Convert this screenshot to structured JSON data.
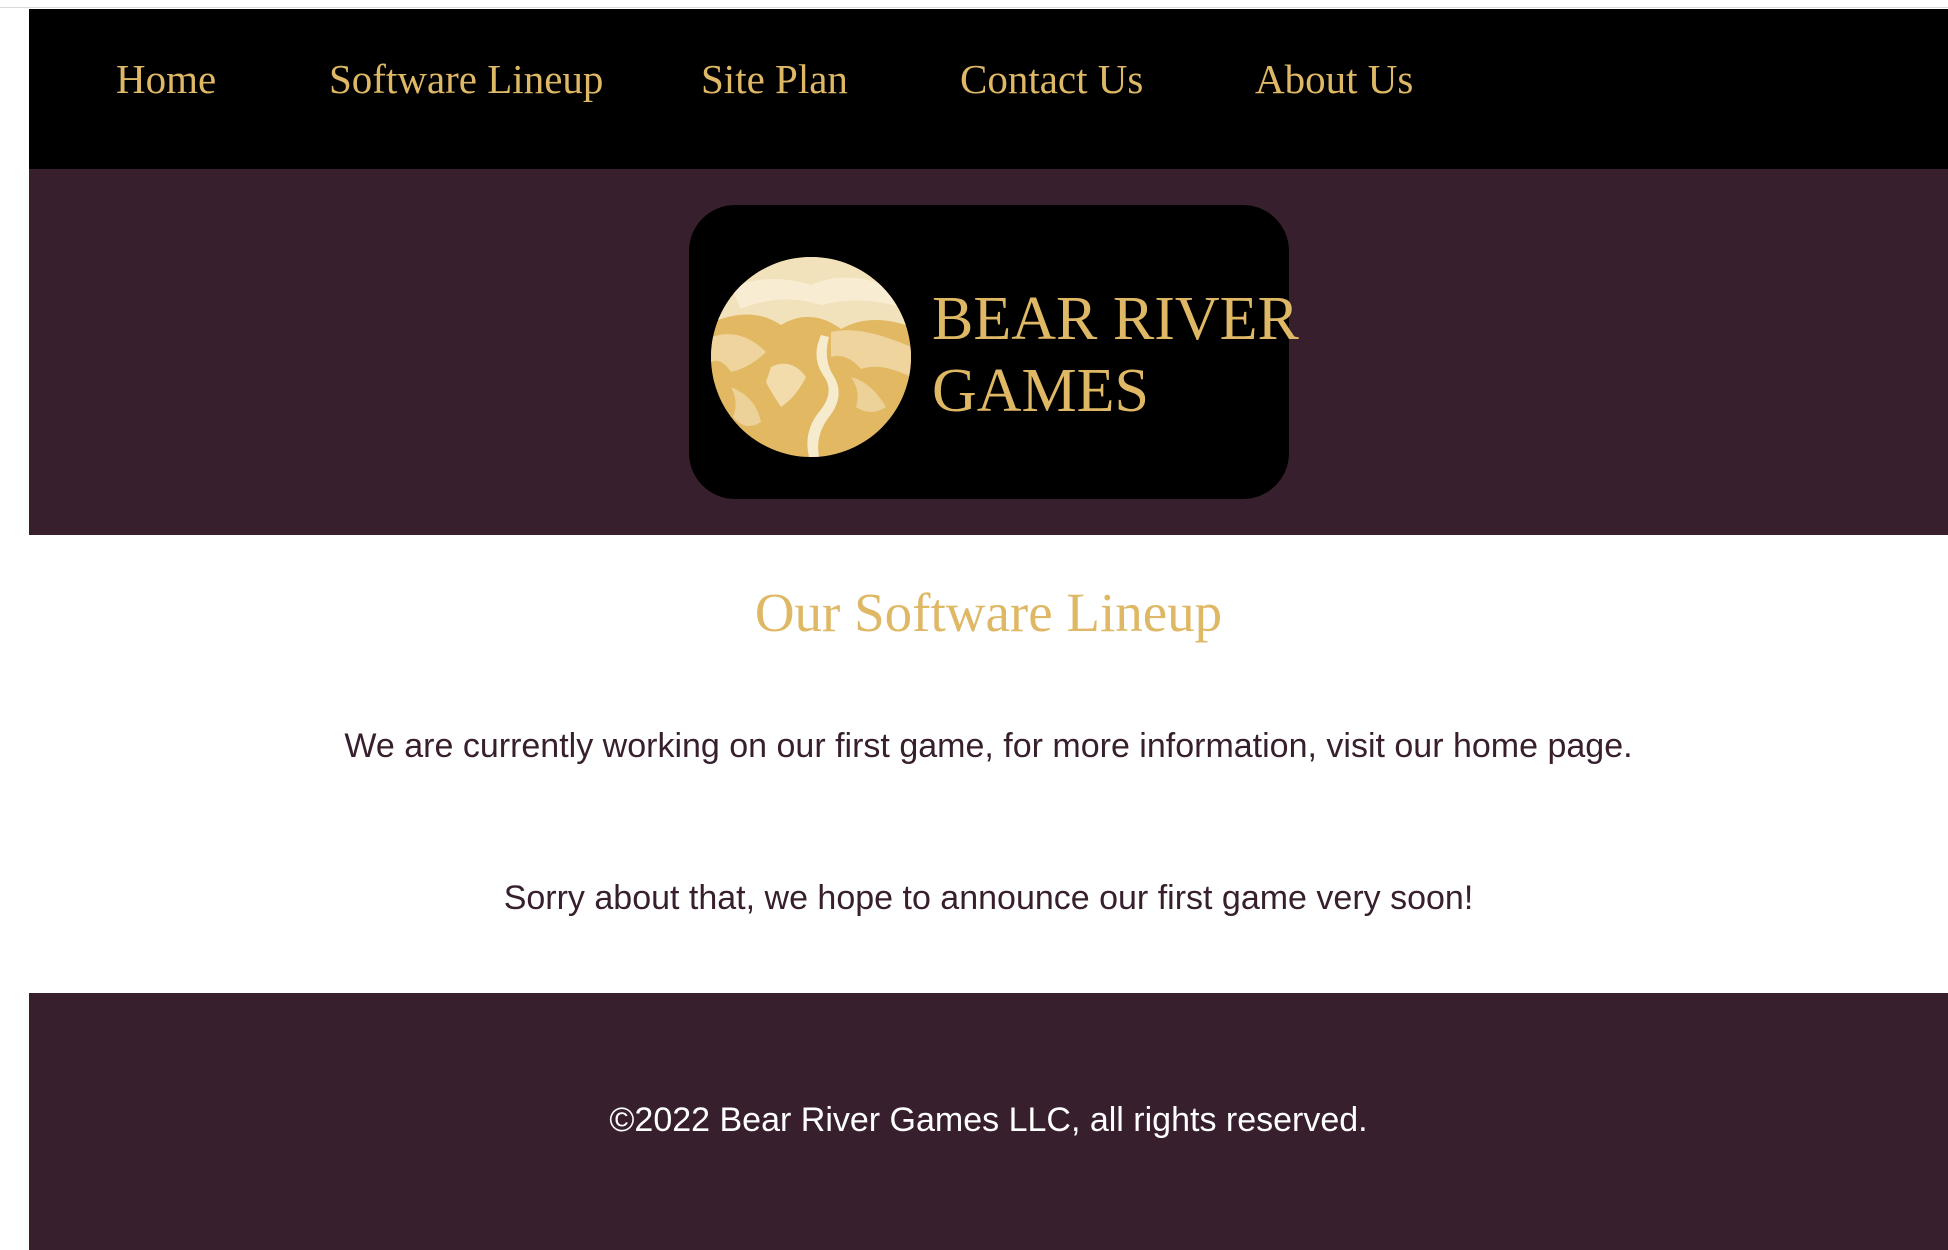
{
  "nav": {
    "items": [
      {
        "label": "Home"
      },
      {
        "label": "Software Lineup"
      },
      {
        "label": "Site Plan"
      },
      {
        "label": "Contact Us"
      },
      {
        "label": "About Us"
      }
    ]
  },
  "hero": {
    "logo_line1": "BEAR RIVER",
    "logo_line2": "GAMES",
    "logo_icon": "mountain-river-moon-icon"
  },
  "main": {
    "title": "Our Software Lineup",
    "paragraph1": "We are currently working on our first game, for more information, visit our home page.",
    "paragraph2": "Sorry about that, we hope to announce our first game very soon!"
  },
  "footer": {
    "copyright": "©2022 Bear River Games LLC, all rights reserved."
  },
  "colors": {
    "nav_bg": "#000000",
    "accent_gold": "#dfb865",
    "plum": "#371f2d",
    "white": "#ffffff"
  }
}
